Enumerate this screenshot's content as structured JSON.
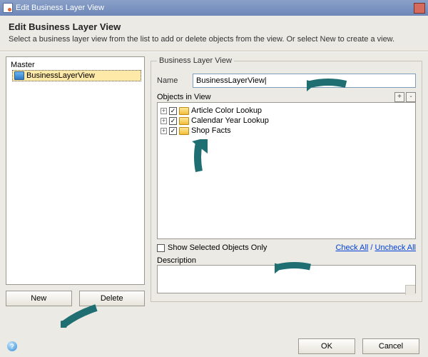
{
  "window": {
    "title": "Edit Business Layer View"
  },
  "heading": {
    "title": "Edit Business Layer View",
    "subtitle": "Select a business layer view from the list to add or delete objects from the view. Or select New to create a view."
  },
  "left": {
    "root": "Master",
    "selected": "BusinessLayerView",
    "new_btn": "New",
    "delete_btn": "Delete"
  },
  "right": {
    "group_label": "Business Layer View",
    "name_label": "Name",
    "name_value": "BusinessLayerView|",
    "objects_label": "Objects in View",
    "tool_expand": "+",
    "tool_collapse": "-",
    "items": [
      {
        "label": "Article Color Lookup",
        "checked": true
      },
      {
        "label": "Calendar Year Lookup",
        "checked": true
      },
      {
        "label": "Shop Facts",
        "checked": true
      }
    ],
    "show_selected": "Show Selected Objects Only",
    "check_all": "Check All",
    "uncheck_all": "Uncheck All",
    "desc_label": "Description",
    "desc_value": ""
  },
  "footer": {
    "ok": "OK",
    "cancel": "Cancel",
    "help": "?"
  },
  "arrows": {
    "color": "#1f6e72"
  }
}
